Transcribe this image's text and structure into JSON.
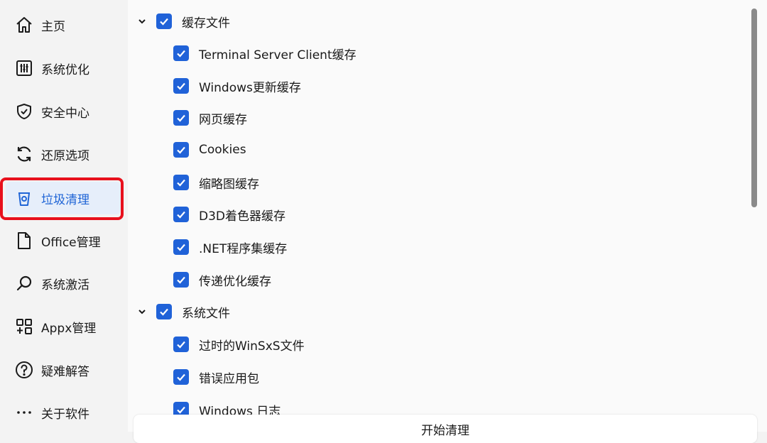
{
  "sidebar": {
    "items": [
      {
        "label": "主页",
        "icon": "home-icon"
      },
      {
        "label": "系统优化",
        "icon": "sliders-icon"
      },
      {
        "label": "安全中心",
        "icon": "shield-icon"
      },
      {
        "label": "还原选项",
        "icon": "refresh-icon"
      },
      {
        "label": "垃圾清理",
        "icon": "trash-icon",
        "active": true
      },
      {
        "label": "Office管理",
        "icon": "document-icon"
      },
      {
        "label": "系统激活",
        "icon": "search-icon"
      },
      {
        "label": "Appx管理",
        "icon": "apps-icon"
      },
      {
        "label": "疑难解答",
        "icon": "help-icon"
      },
      {
        "label": "关于软件",
        "icon": "more-icon"
      }
    ]
  },
  "groups": [
    {
      "label": "缓存文件",
      "checked": true,
      "expanded": true,
      "items": [
        "Terminal Server Client缓存",
        "Windows更新缓存",
        "网页缓存",
        "Cookies",
        "缩略图缓存",
        "D3D着色器缓存",
        ".NET程序集缓存",
        "传递优化缓存"
      ]
    },
    {
      "label": "系统文件",
      "checked": true,
      "expanded": true,
      "items": [
        "过时的WinSxS文件",
        "错误应用包",
        "Windows 日志"
      ]
    }
  ],
  "actions": {
    "start_label": "开始清理"
  },
  "colors": {
    "accent": "#2062d8",
    "highlight_border": "#e8101c",
    "active_bg": "#e6eefa"
  }
}
